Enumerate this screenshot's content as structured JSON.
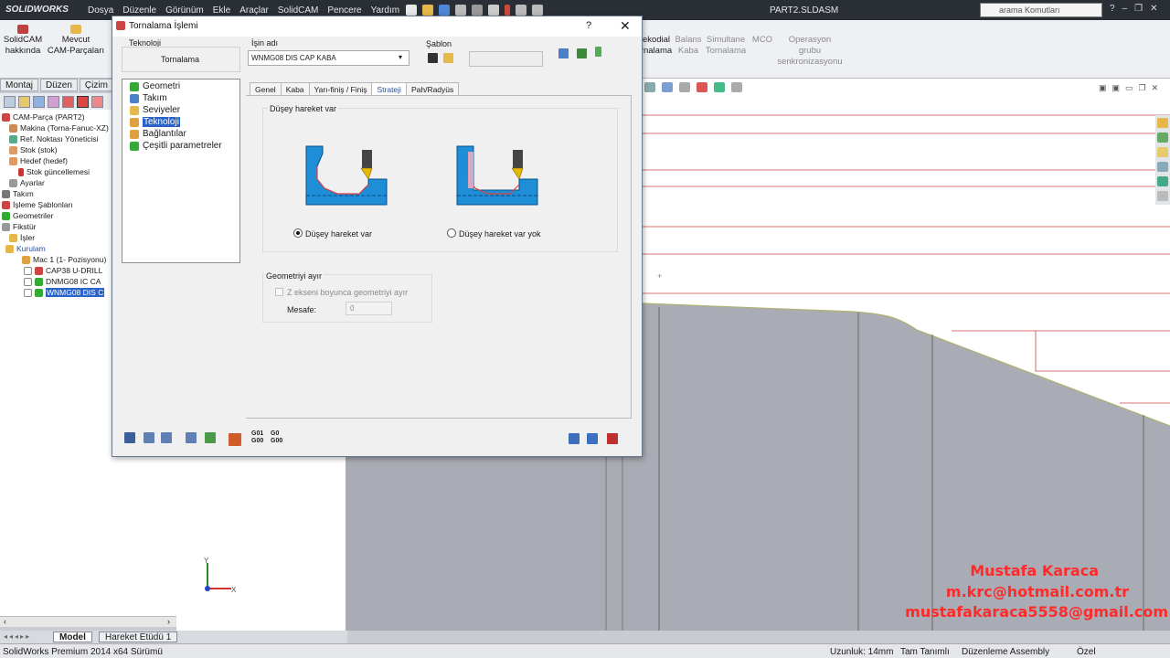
{
  "app": {
    "logo": "SOLIDWORKS",
    "menu": [
      "Dosya",
      "Düzenle",
      "Görünüm",
      "Ekle",
      "Araçlar",
      "SolidCAM",
      "Pencere",
      "Yardım"
    ],
    "document_title": "PART2.SLDASM",
    "search_placeholder": "arama Komutları"
  },
  "ribbon": {
    "buttons": [
      {
        "label": "SolidCAM hakkında",
        "enabled": true
      },
      {
        "label": "Mevcut CAM-Parçaları",
        "enabled": true
      },
      {
        "label": "...kodial ...rnalama",
        "enabled": true
      },
      {
        "label": "Balans Kaba",
        "enabled": false
      },
      {
        "label": "Simultane Tornalama",
        "enabled": false
      },
      {
        "label": "MCO",
        "enabled": false
      },
      {
        "label": "Operasyon grubu senkronizasyonu",
        "enabled": false
      }
    ],
    "b0": "SolidCAM\nhakkında",
    "b1": "Mevcut\nCAM-Parçaları",
    "b2": "ekodial\nrnalama",
    "b3": "Balans\nKaba",
    "b4": "Simultane\nTornalama",
    "b5": "MCO",
    "b6": "Operasyon\ngrubu\nsenkronizasyonu"
  },
  "left_tabs": [
    "Montaj",
    "Düzen",
    "Çizim"
  ],
  "feature_tree": [
    {
      "label": "CAM-Parça (PART2)"
    },
    {
      "label": "Makina (Torna-Fanuc-XZ)"
    },
    {
      "label": "Ref. Noktası Yöneticisi"
    },
    {
      "label": "Stok (stok)"
    },
    {
      "label": "Hedef (hedef)"
    },
    {
      "label": "Stok güncellemesi"
    },
    {
      "label": "Ayarlar"
    },
    {
      "label": "Takım"
    },
    {
      "label": "İşleme Şablonları"
    },
    {
      "label": "Geometriler"
    },
    {
      "label": "Fikstür"
    },
    {
      "label": "İşler"
    },
    {
      "label": "Kurulam"
    },
    {
      "label": "Mac 1 (1- Pozisyonu)"
    },
    {
      "label": "CAP38 U-DRILL"
    },
    {
      "label": "DNMG08 IC CA"
    },
    {
      "label": "WNMG08 DIS C",
      "selected": true
    }
  ],
  "bottom_tabs": {
    "model": "Model",
    "motion": "Hareket Etüdü 1"
  },
  "status": {
    "version": "SolidWorks Premium 2014 x64 Sürümü",
    "length": "Uzunluk: 14mm",
    "defined": "Tam Tanımlı",
    "mode": "Düzenleme Assembly",
    "custom": "Özel"
  },
  "watermark": {
    "name": "Mustafa Karaca",
    "email1": "m.krc@hotmail.com.tr",
    "email2": "mustafakaraca5558@gmail.com"
  },
  "dialog": {
    "title": "Tornalama İşlemi",
    "help": "?",
    "close": "✕",
    "technology_label": "Teknoloji",
    "technology_value": "Tornalama",
    "job_name_label": "İşin adı",
    "job_name_value": "WNMG08 DIS CAP KABA",
    "template_label": "Şablon",
    "tree": [
      {
        "label": "Geometri"
      },
      {
        "label": "Takım"
      },
      {
        "label": "Seviyeler"
      },
      {
        "label": "Teknoloji",
        "selected": true
      },
      {
        "label": "Bağlantılar"
      },
      {
        "label": "Çeşitli parametreler"
      }
    ],
    "tabs": [
      "Genel",
      "Kaba",
      "Yarı-finiş / Finiş",
      "Strateji",
      "Pah/Radyüs"
    ],
    "active_tab": "Strateji",
    "group1_title": "Düşey hareket var",
    "radio_yes": "Düşey hareket var",
    "radio_no": "Düşey hareket var yok",
    "radio_selected": "yes",
    "group2_title": "Geometriyi ayır",
    "checkbox_label": "Z ekseni boyunca geometriyi ayır",
    "checkbox_checked": false,
    "distance_label": "Mesafe:",
    "distance_value": "0",
    "gcode_label1": "G01\nG00",
    "gcode_label2": "G0\nG00"
  },
  "colors": {
    "accent_blue": "#2a64c8",
    "diagram_blue": "#1e8fd6",
    "watermark_red": "#ff2a2a",
    "part_gray": "#a9acb4"
  }
}
